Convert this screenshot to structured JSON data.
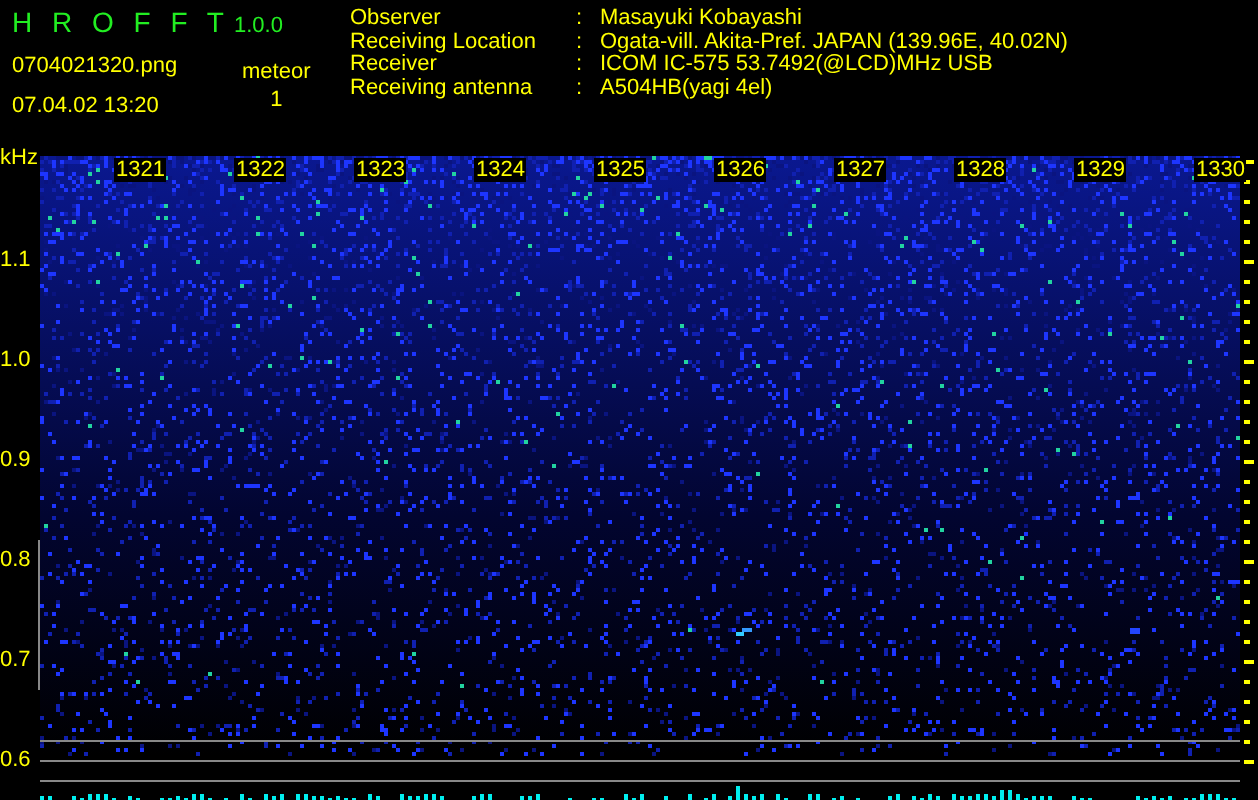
{
  "app": {
    "name": "H R O F F T",
    "version": "1.0.0"
  },
  "file": {
    "filename": "0704021320.png",
    "datetime": "07.04.02 13:20"
  },
  "meteor": {
    "label": "meteor",
    "count": "1"
  },
  "info": [
    {
      "label": "Observer",
      "value": "Masayuki Kobayashi"
    },
    {
      "label": "Receiving Location",
      "value": "Ogata-vill. Akita-Pref. JAPAN (139.96E, 40.02N)"
    },
    {
      "label": "Receiver",
      "value": "ICOM IC-575 53.7492(@LCD)MHz USB"
    },
    {
      "label": "Receiving antenna",
      "value": "A504HB(yagi 4el)"
    }
  ],
  "separator": ":",
  "spectrogram": {
    "unit": "kHz",
    "time_labels": [
      "1321",
      "1322",
      "1323",
      "1324",
      "1325",
      "1326",
      "1327",
      "1328",
      "1329",
      "1330"
    ],
    "freq_labels": [
      "1.1",
      "1.0",
      "0.9",
      "0.8",
      "0.7",
      "0.6"
    ]
  }
}
